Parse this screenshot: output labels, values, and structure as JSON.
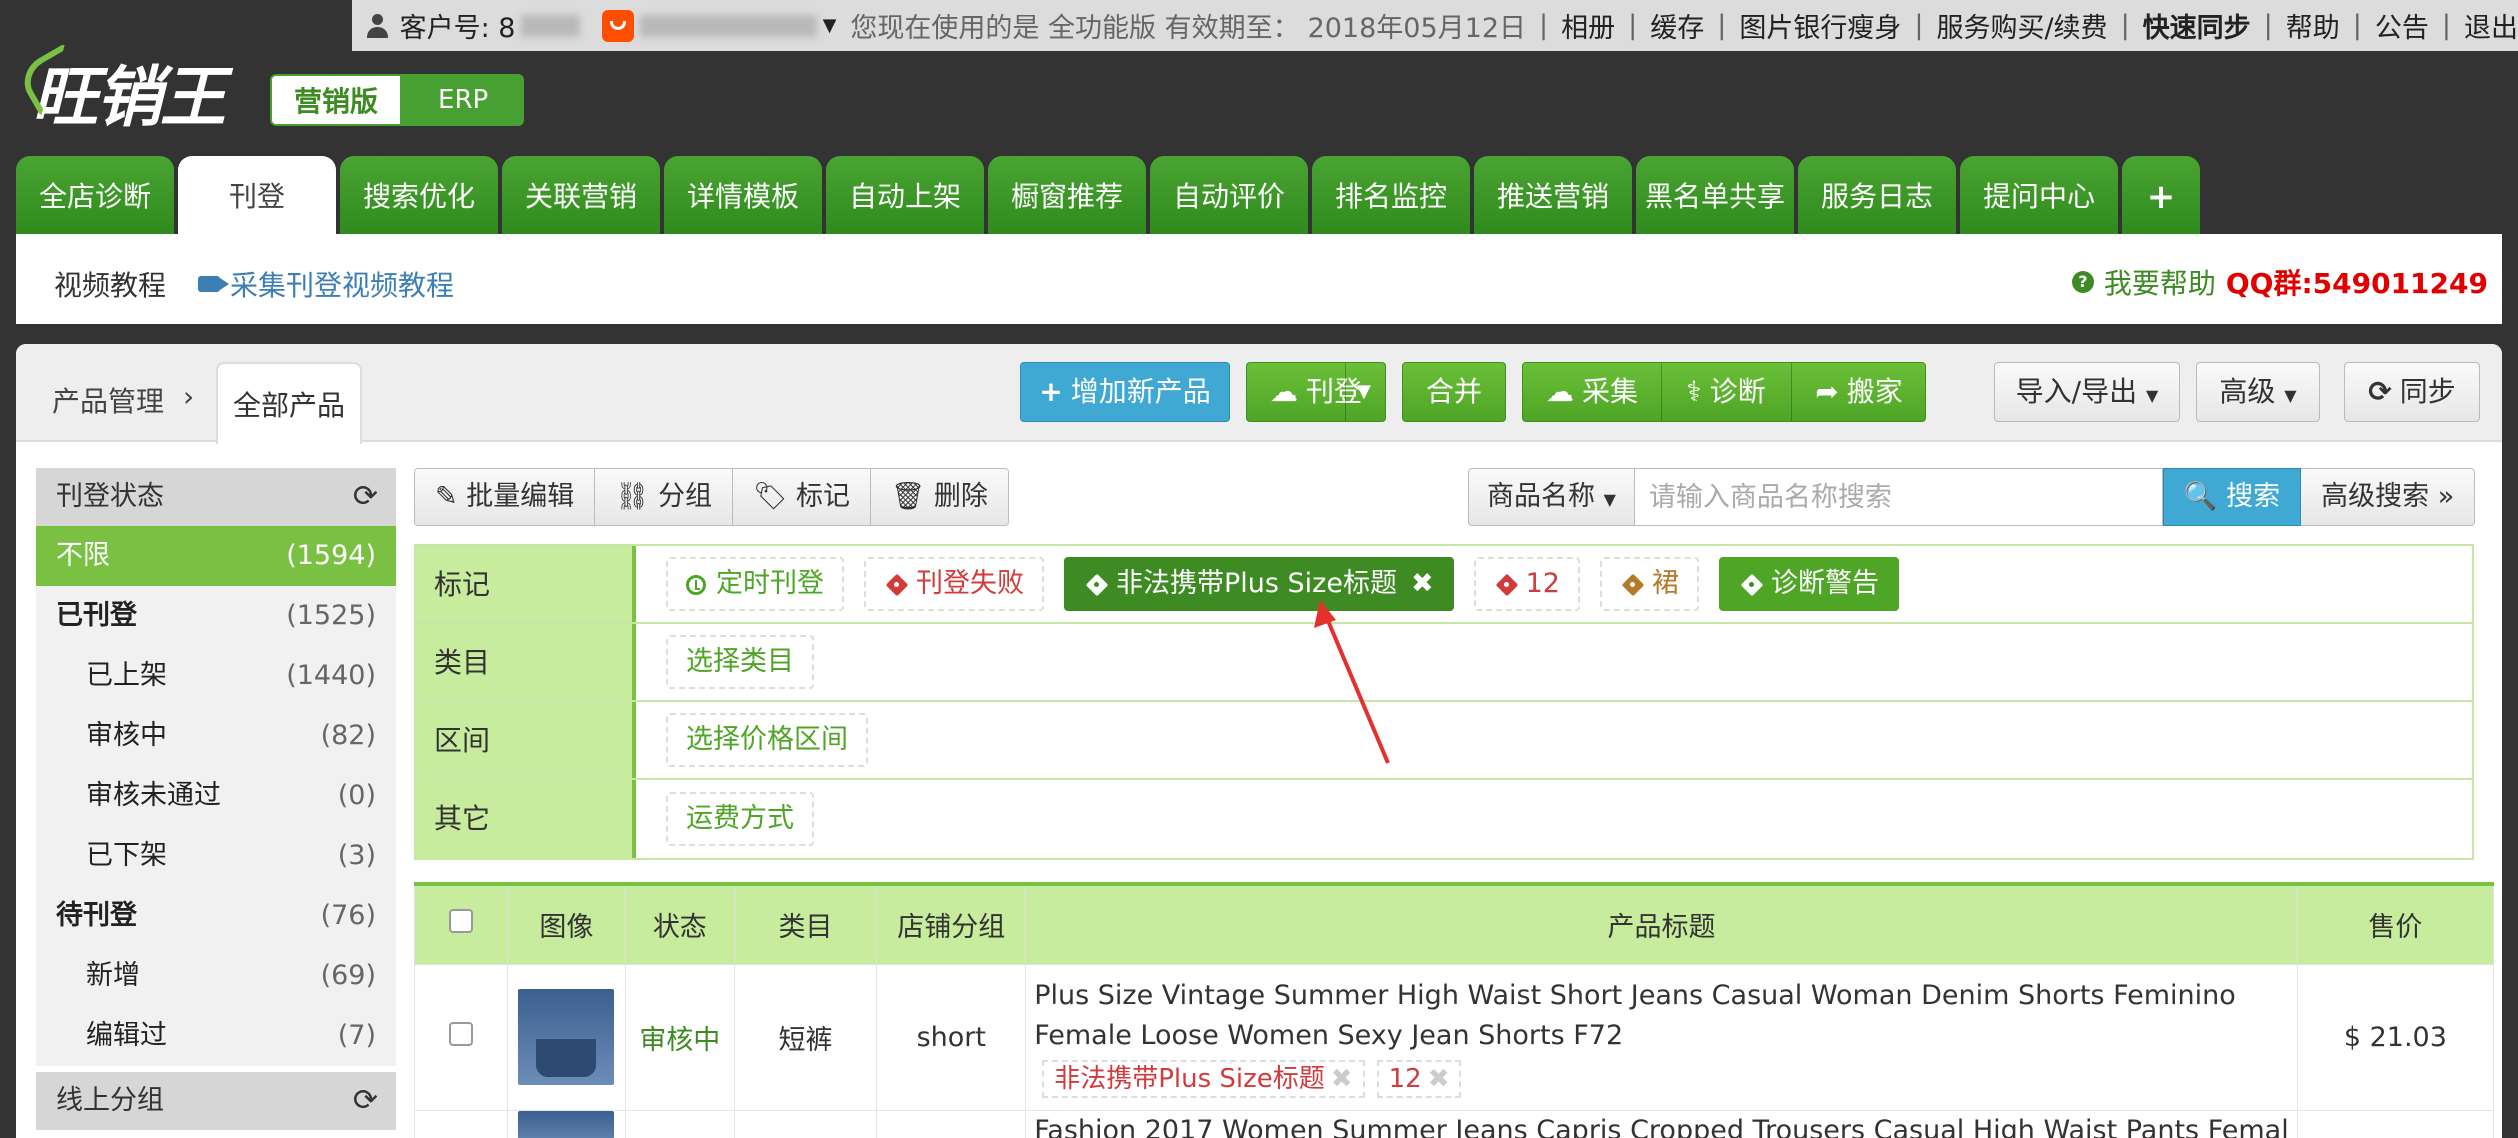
{
  "topbar": {
    "customer_label": "客户号: 8",
    "version_text": "您现在使用的是 全功能版 有效期至：",
    "expiry": "2018年05月12日",
    "links": [
      "相册",
      "缓存",
      "图片银行瘦身",
      "服务购买/续费",
      "快速同步",
      "帮助",
      "公告",
      "退出"
    ]
  },
  "logo": {
    "text": "旺销王"
  },
  "version_toggle": {
    "active": "营销版",
    "inactive": "ERP"
  },
  "nav": {
    "tabs": [
      {
        "label": "全店诊断",
        "active": false
      },
      {
        "label": "刊登",
        "active": true
      },
      {
        "label": "搜索优化",
        "active": false
      },
      {
        "label": "关联营销",
        "active": false
      },
      {
        "label": "详情模板",
        "active": false
      },
      {
        "label": "自动上架",
        "active": false
      },
      {
        "label": "橱窗推荐",
        "active": false
      },
      {
        "label": "自动评价",
        "active": false
      },
      {
        "label": "排名监控",
        "active": false
      },
      {
        "label": "推送营销",
        "active": false
      },
      {
        "label": "黑名单共享",
        "active": false
      },
      {
        "label": "服务日志",
        "active": false
      },
      {
        "label": "提问中心",
        "active": false
      },
      {
        "label": "+",
        "active": false
      }
    ]
  },
  "subbar": {
    "video_label": "视频教程",
    "video_link": "采集刊登视频教程",
    "help_label": "我要帮助",
    "qq": "QQ群:549011249"
  },
  "breadcrumb": {
    "parent": "产品管理",
    "arrow": "›",
    "current": "全部产品"
  },
  "toolbar": {
    "add_product": "增加新产品",
    "publish": "刊登",
    "merge": "合并",
    "collect": "采集",
    "diagnose": "诊断",
    "move": "搬家",
    "import_export": "导入/导出",
    "advanced": "高级",
    "sync": "同步"
  },
  "sidebar": {
    "status_header": "刊登状态",
    "items": [
      {
        "label": "不限",
        "count": "(1594)",
        "level": 0,
        "active": true,
        "bold": false
      },
      {
        "label": "已刊登",
        "count": "(1525)",
        "level": 0,
        "active": false,
        "bold": true
      },
      {
        "label": "已上架",
        "count": "(1440)",
        "level": 1,
        "active": false,
        "bold": false
      },
      {
        "label": "审核中",
        "count": "(82)",
        "level": 1,
        "active": false,
        "bold": false
      },
      {
        "label": "审核未通过",
        "count": "(0)",
        "level": 1,
        "active": false,
        "bold": false
      },
      {
        "label": "已下架",
        "count": "(3)",
        "level": 1,
        "active": false,
        "bold": false
      },
      {
        "label": "待刊登",
        "count": "(76)",
        "level": 0,
        "active": false,
        "bold": true
      },
      {
        "label": "新增",
        "count": "(69)",
        "level": 1,
        "active": false,
        "bold": false
      },
      {
        "label": "编辑过",
        "count": "(7)",
        "level": 1,
        "active": false,
        "bold": false
      }
    ],
    "group_header": "线上分组"
  },
  "actions": {
    "batch_edit": "批量编辑",
    "group": "分组",
    "mark": "标记",
    "delete": "删除"
  },
  "search": {
    "field": "商品名称",
    "placeholder": "请输入商品名称搜索",
    "button": "搜索",
    "advanced": "高级搜索"
  },
  "filters": {
    "mark_label": "标记",
    "marks": [
      {
        "label": "定时刊登",
        "style": "green",
        "icon": "clock-icon"
      },
      {
        "label": "刊登失败",
        "style": "red",
        "icon": "tag-icon"
      },
      {
        "label": "非法携带Plus Size标题",
        "style": "selected",
        "icon": "tag-icon"
      },
      {
        "label": "12",
        "style": "red",
        "icon": "tag-icon"
      },
      {
        "label": "裙",
        "style": "orange",
        "icon": "tag-icon"
      },
      {
        "label": "诊断警告",
        "style": "warn",
        "icon": "tag-icon"
      }
    ],
    "category_label": "类目",
    "category_chip": "选择类目",
    "price_label": "区间",
    "price_chip": "选择价格区间",
    "other_label": "其它",
    "other_chip": "运费方式"
  },
  "table": {
    "headers": [
      "图像",
      "状态",
      "类目",
      "店铺分组",
      "产品标题",
      "售价"
    ],
    "rows": [
      {
        "status": "审核中",
        "category": "短裤",
        "group": "short",
        "title": "Plus Size Vintage Summer High Waist Short Jeans Casual Woman Denim Shorts Feminino Female Loose Women Sexy Jean Shorts F72",
        "tags": [
          "非法携带Plus Size标题",
          "12"
        ],
        "price": "$ 21.03"
      },
      {
        "title": "Fashion 2017 Women Summer Jeans Capris Cropped Trousers Casual High Waist Pants Femal"
      }
    ]
  },
  "colors": {
    "brand_green": "#4ea526",
    "accent_blue": "#3fa9d3",
    "alert_red": "#e00000"
  }
}
